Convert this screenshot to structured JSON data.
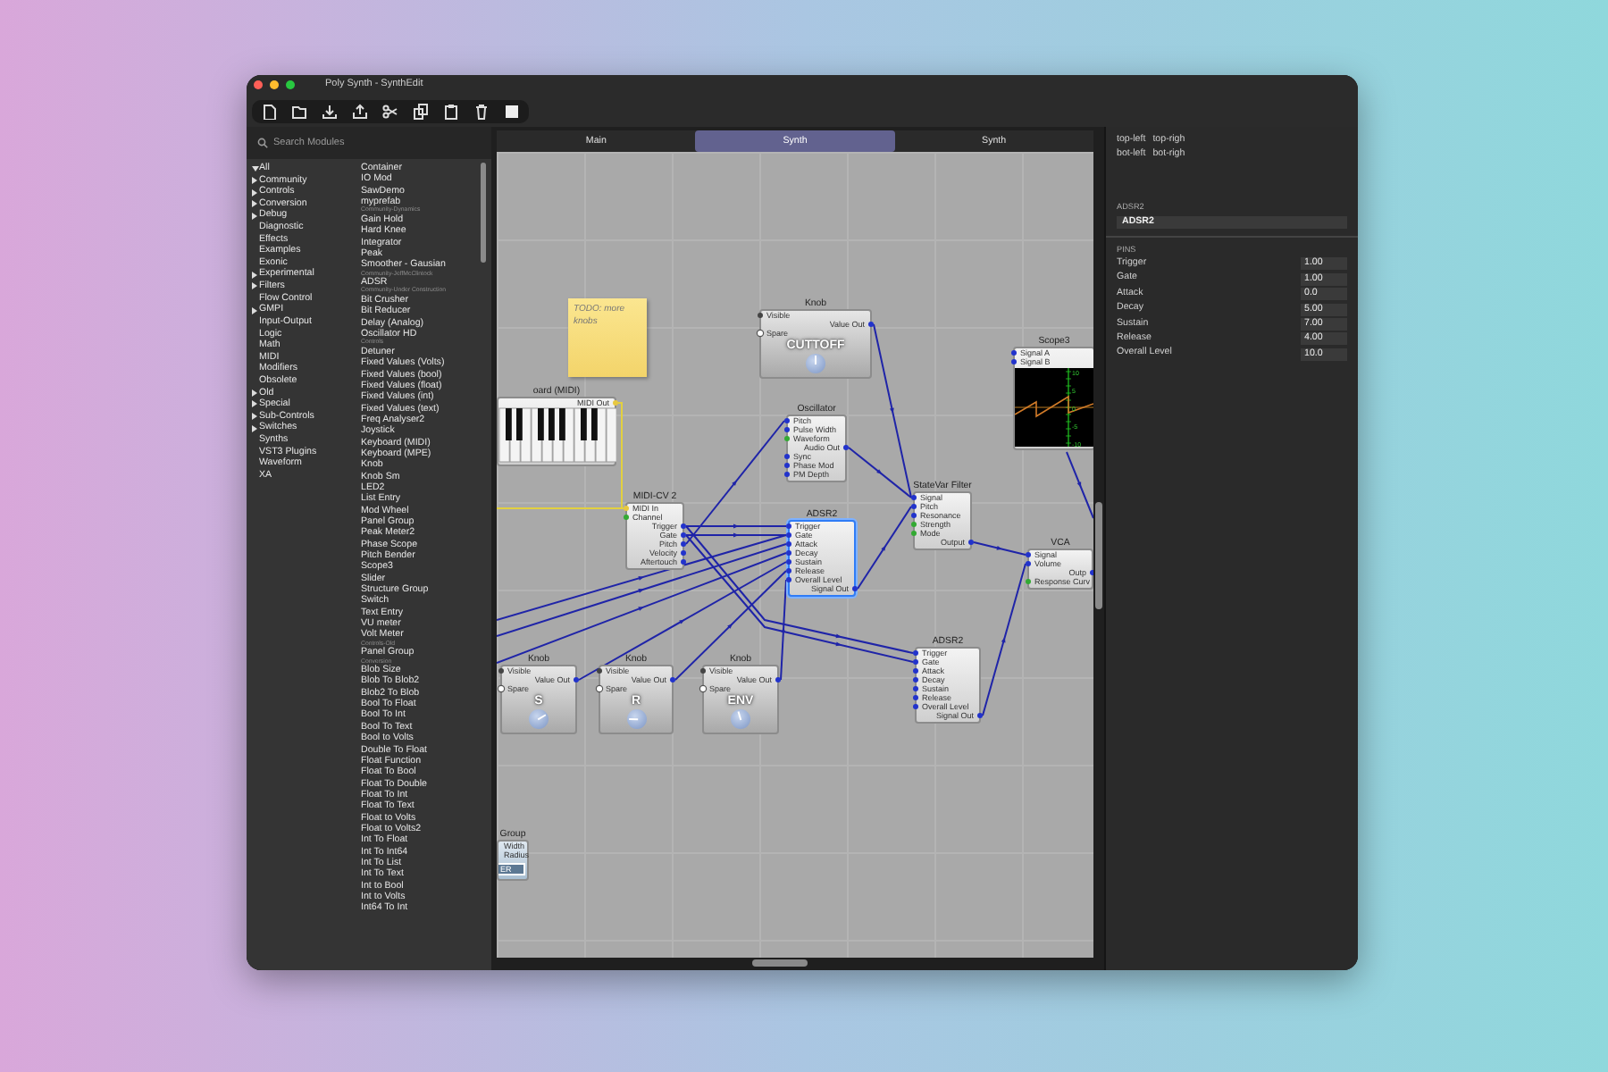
{
  "window": {
    "title": "Poly Synth - SynthEdit"
  },
  "sidebar": {
    "search": {
      "placeholder": "Search Modules"
    },
    "categories": [
      {
        "label": "All",
        "kind": "expanded"
      },
      {
        "label": "Community",
        "kind": "collapsed"
      },
      {
        "label": "Controls",
        "kind": "collapsed"
      },
      {
        "label": "Conversion",
        "kind": "collapsed"
      },
      {
        "label": "Debug",
        "kind": "collapsed"
      },
      {
        "label": "Diagnostic",
        "kind": "leaf"
      },
      {
        "label": "Effects",
        "kind": "leaf"
      },
      {
        "label": "Examples",
        "kind": "leaf"
      },
      {
        "label": "Exonic",
        "kind": "leaf"
      },
      {
        "label": "Experimental",
        "kind": "collapsed"
      },
      {
        "label": "Filters",
        "kind": "collapsed"
      },
      {
        "label": "Flow Control",
        "kind": "leaf"
      },
      {
        "label": "GMPI",
        "kind": "collapsed"
      },
      {
        "label": "Input-Output",
        "kind": "leaf"
      },
      {
        "label": "Logic",
        "kind": "leaf"
      },
      {
        "label": "Math",
        "kind": "leaf"
      },
      {
        "label": "MIDI",
        "kind": "leaf"
      },
      {
        "label": "Modifiers",
        "kind": "leaf"
      },
      {
        "label": "Obsolete",
        "kind": "leaf"
      },
      {
        "label": "Old",
        "kind": "collapsed"
      },
      {
        "label": "Special",
        "kind": "collapsed"
      },
      {
        "label": "Sub-Controls",
        "kind": "collapsed"
      },
      {
        "label": "Switches",
        "kind": "collapsed"
      },
      {
        "label": "Synths",
        "kind": "leaf"
      },
      {
        "label": "VST3 Plugins",
        "kind": "leaf"
      },
      {
        "label": "Waveform",
        "kind": "leaf"
      },
      {
        "label": "XA",
        "kind": "leaf"
      }
    ],
    "modules": [
      {
        "label": "Container",
        "kind": "module"
      },
      {
        "label": "IO Mod",
        "kind": "module"
      },
      {
        "label": "SawDemo",
        "kind": "module"
      },
      {
        "label": "myprefab",
        "kind": "module"
      },
      {
        "label": "Community-Dynamics",
        "kind": "header"
      },
      {
        "label": "Gain Hold",
        "kind": "module"
      },
      {
        "label": "Hard Knee",
        "kind": "module"
      },
      {
        "label": "Integrator",
        "kind": "module"
      },
      {
        "label": "Peak",
        "kind": "module"
      },
      {
        "label": "Smoother - Gausian",
        "kind": "module"
      },
      {
        "label": "Community-JeffMcClintock",
        "kind": "header"
      },
      {
        "label": "ADSR",
        "kind": "module"
      },
      {
        "label": "Community-Under Construction",
        "kind": "header"
      },
      {
        "label": "Bit Crusher",
        "kind": "module"
      },
      {
        "label": "Bit Reducer",
        "kind": "module"
      },
      {
        "label": "Delay (Analog)",
        "kind": "module"
      },
      {
        "label": "Oscillator HD",
        "kind": "module"
      },
      {
        "label": "Controls",
        "kind": "header"
      },
      {
        "label": "Detuner",
        "kind": "module"
      },
      {
        "label": "Fixed Values (Volts)",
        "kind": "module"
      },
      {
        "label": "Fixed Values (bool)",
        "kind": "module"
      },
      {
        "label": "Fixed Values (float)",
        "kind": "module"
      },
      {
        "label": "Fixed Values (int)",
        "kind": "module"
      },
      {
        "label": "Fixed Values (text)",
        "kind": "module"
      },
      {
        "label": "Freq Analyser2",
        "kind": "module"
      },
      {
        "label": "Joystick",
        "kind": "module"
      },
      {
        "label": "Keyboard (MIDI)",
        "kind": "module"
      },
      {
        "label": "Keyboard (MPE)",
        "kind": "module"
      },
      {
        "label": "Knob",
        "kind": "module"
      },
      {
        "label": "Knob Sm",
        "kind": "module"
      },
      {
        "label": "LED2",
        "kind": "module"
      },
      {
        "label": "List Entry",
        "kind": "module"
      },
      {
        "label": "Mod Wheel",
        "kind": "module"
      },
      {
        "label": "Panel Group",
        "kind": "module"
      },
      {
        "label": "Peak Meter2",
        "kind": "module"
      },
      {
        "label": "Phase Scope",
        "kind": "module"
      },
      {
        "label": "Pitch Bender",
        "kind": "module"
      },
      {
        "label": "Scope3",
        "kind": "module"
      },
      {
        "label": "Slider",
        "kind": "module"
      },
      {
        "label": "Structure Group",
        "kind": "module"
      },
      {
        "label": "Switch",
        "kind": "module"
      },
      {
        "label": "Text Entry",
        "kind": "module"
      },
      {
        "label": "VU meter",
        "kind": "module"
      },
      {
        "label": "Volt Meter",
        "kind": "module"
      },
      {
        "label": "Controls-Old",
        "kind": "header"
      },
      {
        "label": "Panel Group",
        "kind": "module"
      },
      {
        "label": "Conversion",
        "kind": "header"
      },
      {
        "label": "Blob Size",
        "kind": "module"
      },
      {
        "label": "Blob To Blob2",
        "kind": "module"
      },
      {
        "label": "Blob2 To Blob",
        "kind": "module"
      },
      {
        "label": "Bool To Float",
        "kind": "module"
      },
      {
        "label": "Bool To Int",
        "kind": "module"
      },
      {
        "label": "Bool To Text",
        "kind": "module"
      },
      {
        "label": "Bool to Volts",
        "kind": "module"
      },
      {
        "label": "Double To Float",
        "kind": "module"
      },
      {
        "label": "Float Function",
        "kind": "module"
      },
      {
        "label": "Float To Bool",
        "kind": "module"
      },
      {
        "label": "Float To Double",
        "kind": "module"
      },
      {
        "label": "Float To Int",
        "kind": "module"
      },
      {
        "label": "Float To Text",
        "kind": "module"
      },
      {
        "label": "Float to Volts",
        "kind": "module"
      },
      {
        "label": "Float to Volts2",
        "kind": "module"
      },
      {
        "label": "Int To Float",
        "kind": "module"
      },
      {
        "label": "Int To Int64",
        "kind": "module"
      },
      {
        "label": "Int To List",
        "kind": "module"
      },
      {
        "label": "Int To Text",
        "kind": "module"
      },
      {
        "label": "Int to Bool",
        "kind": "module"
      },
      {
        "label": "Int to Volts",
        "kind": "module"
      },
      {
        "label": "Int64 To Int",
        "kind": "module"
      }
    ]
  },
  "tabs": [
    {
      "label": "Main",
      "selected": false
    },
    {
      "label": "Synth",
      "selected": true
    },
    {
      "label": "Synth",
      "selected": false
    }
  ],
  "canvas": {
    "nodes": [
      {
        "kind": "note",
        "text": "TODO: more knobs",
        "selected": false
      },
      {
        "kind": "knob",
        "title": "Knob",
        "selected": false,
        "pins": [
          {
            "label": "Visible",
            "output": false,
            "color": "#444444"
          },
          {
            "label": "Value Out",
            "output": true,
            "color": "#2233cc"
          },
          {
            "label": "Spare",
            "output": false,
            "color": "#ffffff"
          }
        ],
        "label": "CUTTOFF",
        "level": 0.5
      },
      {
        "kind": "scope",
        "title": "Scope3",
        "selected": false,
        "pins": [
          {
            "label": "Signal A",
            "output": false,
            "color": "#2233cc"
          },
          {
            "label": "Signal B",
            "output": false,
            "color": "#2233cc"
          }
        ],
        "axis_labels": [
          "10",
          "5",
          "0",
          "-5",
          "-10"
        ]
      },
      {
        "kind": "keyboard",
        "title": "oard (MIDI)",
        "selected": false,
        "pins": [
          {
            "label": "MIDI Out",
            "output": true,
            "color": "#e8c840"
          }
        ]
      },
      {
        "kind": "module",
        "title": "Oscillator",
        "selected": false,
        "pins": [
          {
            "label": "Pitch",
            "output": false,
            "color": "#2233cc"
          },
          {
            "label": "Pulse Width",
            "output": false,
            "color": "#2233cc"
          },
          {
            "label": "Waveform",
            "output": false,
            "color": "#33aa33"
          },
          {
            "label": "Audio Out",
            "output": true,
            "color": "#2233cc"
          },
          {
            "label": "Sync",
            "output": false,
            "color": "#2233cc"
          },
          {
            "label": "Phase Mod",
            "output": false,
            "color": "#2233cc"
          },
          {
            "label": "PM Depth",
            "output": false,
            "color": "#2233cc"
          }
        ]
      },
      {
        "kind": "module",
        "title": "StateVar Filter",
        "selected": false,
        "pins": [
          {
            "label": "Signal",
            "output": false,
            "color": "#2233cc"
          },
          {
            "label": "Pitch",
            "output": false,
            "color": "#2233cc"
          },
          {
            "label": "Resonance",
            "output": false,
            "color": "#2233cc"
          },
          {
            "label": "Strength",
            "output": false,
            "color": "#33aa33"
          },
          {
            "label": "Mode",
            "output": false,
            "color": "#33aa33"
          },
          {
            "label": "Output",
            "output": true,
            "color": "#2233cc"
          }
        ]
      },
      {
        "kind": "module",
        "title": "MIDI-CV 2",
        "selected": false,
        "pins": [
          {
            "label": "MIDI In",
            "output": false,
            "color": "#e8c840"
          },
          {
            "label": "Channel",
            "output": false,
            "color": "#33aa33"
          },
          {
            "label": "Trigger",
            "output": true,
            "color": "#2233cc"
          },
          {
            "label": "Gate",
            "output": true,
            "color": "#2233cc"
          },
          {
            "label": "Pitch",
            "output": true,
            "color": "#2233cc"
          },
          {
            "label": "Velocity",
            "output": true,
            "color": "#2233cc"
          },
          {
            "label": "Aftertouch",
            "output": true,
            "color": "#2233cc"
          }
        ]
      },
      {
        "kind": "module",
        "title": "ADSR2",
        "selected": true,
        "pins": [
          {
            "label": "Trigger",
            "output": false,
            "color": "#2233cc"
          },
          {
            "label": "Gate",
            "output": false,
            "color": "#2233cc"
          },
          {
            "label": "Attack",
            "output": false,
            "color": "#2233cc"
          },
          {
            "label": "Decay",
            "output": false,
            "color": "#2233cc"
          },
          {
            "label": "Sustain",
            "output": false,
            "color": "#2233cc"
          },
          {
            "label": "Release",
            "output": false,
            "color": "#2233cc"
          },
          {
            "label": "Overall Level",
            "output": false,
            "color": "#2233cc"
          },
          {
            "label": "Signal Out",
            "output": true,
            "color": "#2233cc"
          }
        ]
      },
      {
        "kind": "module",
        "title": "VCA",
        "selected": false,
        "pins": [
          {
            "label": "Signal",
            "output": false,
            "color": "#2233cc"
          },
          {
            "label": "Volume",
            "output": false,
            "color": "#2233cc"
          },
          {
            "label": "Outp",
            "output": true,
            "color": "#2233cc"
          },
          {
            "label": "Response Curv",
            "output": false,
            "color": "#33aa33"
          }
        ]
      },
      {
        "kind": "knob",
        "title": "Knob",
        "selected": false,
        "pins": [
          {
            "label": "Visible",
            "output": false,
            "color": "#444444"
          },
          {
            "label": "Value Out",
            "output": true,
            "color": "#2233cc"
          },
          {
            "label": "Spare",
            "output": false,
            "color": "#ffffff"
          }
        ],
        "label": "S",
        "level": 0.72
      },
      {
        "kind": "knob",
        "title": "Knob",
        "selected": false,
        "pins": [
          {
            "label": "Visible",
            "output": false,
            "color": "#444444"
          },
          {
            "label": "Value Out",
            "output": true,
            "color": "#2233cc"
          },
          {
            "label": "Spare",
            "output": false,
            "color": "#ffffff"
          }
        ],
        "label": "R",
        "level": 0.17
      },
      {
        "kind": "knob",
        "title": "Knob",
        "selected": false,
        "pins": [
          {
            "label": "Visible",
            "output": false,
            "color": "#444444"
          },
          {
            "label": "Value Out",
            "output": true,
            "color": "#2233cc"
          },
          {
            "label": "Spare",
            "output": false,
            "color": "#ffffff"
          }
        ],
        "label": "ENV",
        "level": 0.44
      },
      {
        "kind": "module",
        "title": "ADSR2",
        "selected": false,
        "pins": [
          {
            "label": "Trigger",
            "output": false,
            "color": "#2233cc"
          },
          {
            "label": "Gate",
            "output": false,
            "color": "#2233cc"
          },
          {
            "label": "Attack",
            "output": false,
            "color": "#2233cc"
          },
          {
            "label": "Decay",
            "output": false,
            "color": "#2233cc"
          },
          {
            "label": "Sustain",
            "output": false,
            "color": "#2233cc"
          },
          {
            "label": "Release",
            "output": false,
            "color": "#2233cc"
          },
          {
            "label": "Overall Level",
            "output": false,
            "color": "#2233cc"
          },
          {
            "label": "Signal Out",
            "output": true,
            "color": "#2233cc"
          }
        ]
      },
      {
        "kind": "group",
        "title": "Group",
        "selected": false,
        "pins": [
          {
            "label": "Width",
            "output": false
          },
          {
            "label": "Radius",
            "output": false
          }
        ],
        "label": "ER"
      }
    ]
  },
  "properties": {
    "corner_labels": [
      "top-left",
      "top-righ",
      "bot-left",
      "bot-righ"
    ],
    "name_label": "ADSR2",
    "name_value": "ADSR2",
    "pins_heading": "PINS",
    "pins": [
      {
        "label": "Trigger",
        "value": "1.00"
      },
      {
        "label": "Gate",
        "value": "1.00"
      },
      {
        "label": "Attack",
        "value": "0.0"
      },
      {
        "label": "Decay",
        "value": "5.00"
      },
      {
        "label": "Sustain",
        "value": "7.00"
      },
      {
        "label": "Release",
        "value": "4.00"
      },
      {
        "label": "Overall Level",
        "value": "10.0"
      }
    ]
  }
}
